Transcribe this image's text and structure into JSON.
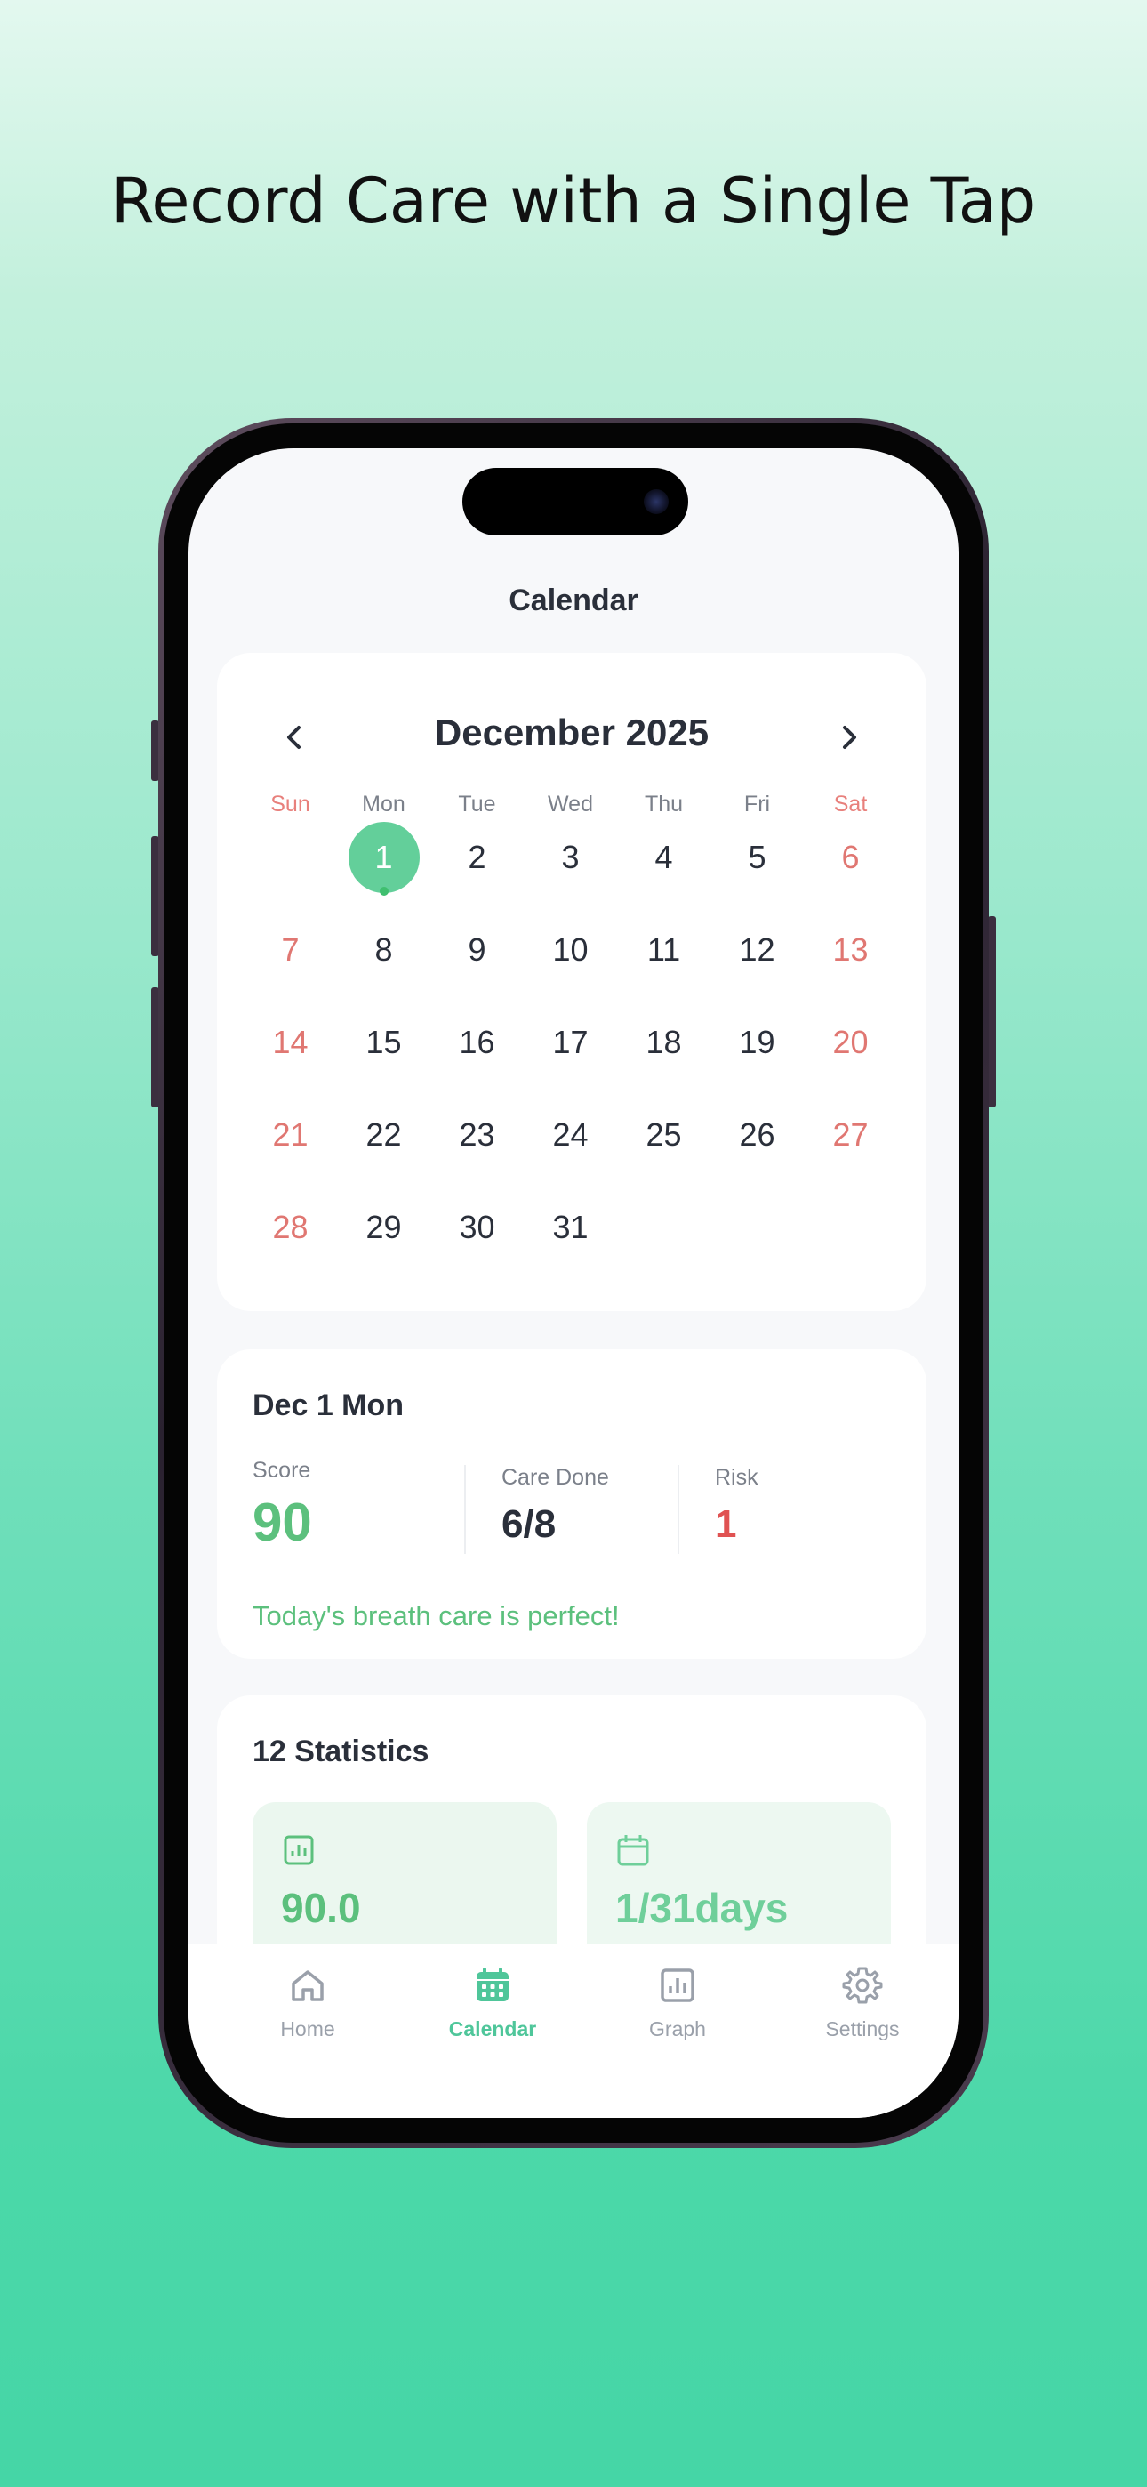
{
  "headline": "Record Care with a Single Tap",
  "screen_title": "Calendar",
  "calendar": {
    "month_label": "December 2025",
    "weekdays": [
      "Sun",
      "Mon",
      "Tue",
      "Wed",
      "Thu",
      "Fri",
      "Sat"
    ],
    "start_offset": 1,
    "days_in_month": 31,
    "selected_day": 1
  },
  "summary": {
    "date_label": "Dec 1 Mon",
    "score_label": "Score",
    "score_value": "90",
    "care_label": "Care Done",
    "care_value": "6/8",
    "risk_label": "Risk",
    "risk_value": "1",
    "message": "Today's breath care is perfect!"
  },
  "statistics": {
    "title": "12 Statistics",
    "tiles": [
      {
        "icon": "bar-chart-icon",
        "value": "90.0"
      },
      {
        "icon": "calendar-icon",
        "value": "1/31days"
      }
    ]
  },
  "tabs": [
    {
      "label": "Home",
      "icon": "home-icon",
      "active": false
    },
    {
      "label": "Calendar",
      "icon": "calendar-icon",
      "active": true
    },
    {
      "label": "Graph",
      "icon": "graph-icon",
      "active": false
    },
    {
      "label": "Settings",
      "icon": "gear-icon",
      "active": false
    }
  ],
  "colors": {
    "accent": "#4fc69a",
    "selected_day": "#63cf9a",
    "weekend": "#e07772",
    "score": "#5cc07d",
    "risk": "#e05252"
  }
}
